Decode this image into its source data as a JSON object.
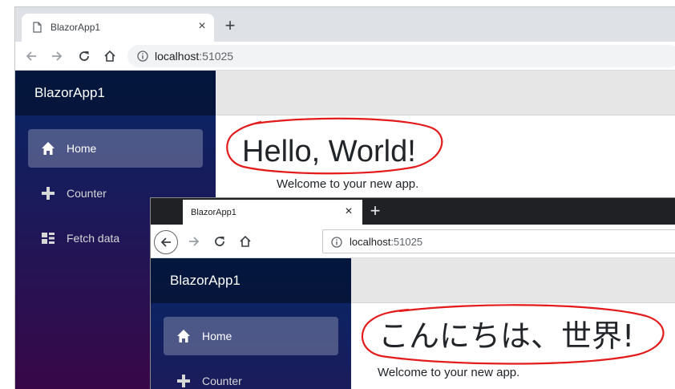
{
  "english": {
    "tab": {
      "title": "BlazorApp1",
      "close": "×"
    },
    "newtab": "+",
    "address": {
      "host": "localhost",
      "port": ":51025"
    },
    "brand": "BlazorApp1",
    "nav": [
      {
        "label": "Home",
        "icon": "home-icon",
        "active": true
      },
      {
        "label": "Counter",
        "icon": "plus-icon",
        "active": false
      },
      {
        "label": "Fetch data",
        "icon": "list-icon",
        "active": false
      }
    ],
    "heading": "Hello, World!",
    "welcome": "Welcome to your new app."
  },
  "japanese": {
    "tab": {
      "title": "BlazorApp1",
      "close": "×"
    },
    "newtab": "+",
    "address": {
      "host": "localhost",
      "port": ":51025"
    },
    "brand": "BlazorApp1",
    "nav": [
      {
        "label": "Home",
        "icon": "home-icon",
        "active": true
      },
      {
        "label": "Counter",
        "icon": "plus-icon",
        "active": false
      }
    ],
    "heading": "こんにちは、世界!",
    "welcome": "Welcome to your new app."
  },
  "colors": {
    "sidebar_top": "#052767",
    "sidebar_bottom": "#3a0647",
    "annotation_red": "#e31b1b",
    "dark_tabstrip": "#202124"
  }
}
